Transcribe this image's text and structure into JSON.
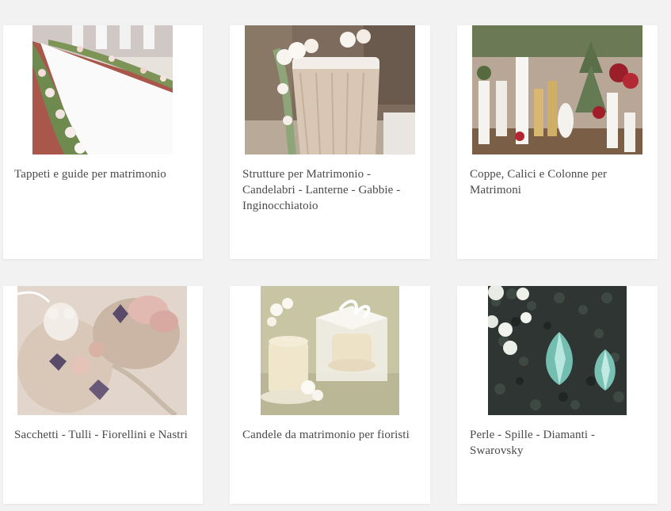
{
  "categories": [
    {
      "label": "Tappeti e guide per matrimonio",
      "image_icon": "wedding-aisle-runner-photo"
    },
    {
      "label": "Strutture per Matrimonio - Candelabri - Lanterne - Gabbie - Inginocchiatoio",
      "image_icon": "wedding-kneeler-photo"
    },
    {
      "label": "Coppe, Calici e Colonne per Matrimoni",
      "image_icon": "wedding-vases-columns-photo"
    },
    {
      "label": "Sacchetti - Tulli - Fiorellini e Nastri",
      "image_icon": "favor-bags-flowers-photo"
    },
    {
      "label": "Candele da matrimonio per fioristi",
      "image_icon": "wedding-candle-photo"
    },
    {
      "label": "Perle - Spille - Diamanti - Swarovsky",
      "image_icon": "crystals-pearls-photo"
    }
  ],
  "colors": {
    "background": "#f3f2f2",
    "card": "#ffffff",
    "caption_text": "#4a4a4a"
  }
}
